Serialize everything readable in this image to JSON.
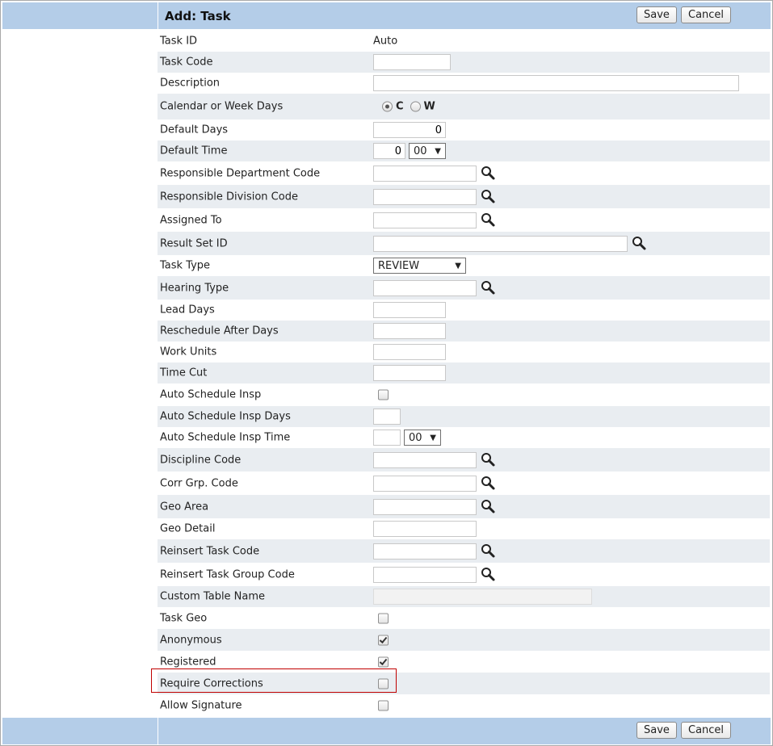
{
  "header": {
    "title": "Add: Task",
    "save_label": "Save",
    "cancel_label": "Cancel"
  },
  "footer": {
    "save_label": "Save",
    "cancel_label": "Cancel"
  },
  "form": {
    "task_id": {
      "label": "Task ID",
      "value": "Auto"
    },
    "task_code": {
      "label": "Task Code",
      "value": ""
    },
    "description": {
      "label": "Description",
      "value": ""
    },
    "calendar_or_week_days": {
      "label": "Calendar or Week Days",
      "options": [
        "C",
        "W"
      ],
      "selected": "C"
    },
    "default_days": {
      "label": "Default Days",
      "value": "0"
    },
    "default_time": {
      "label": "Default Time",
      "hours": "0",
      "minutes": "00"
    },
    "responsible_department_code": {
      "label": "Responsible Department Code",
      "value": ""
    },
    "responsible_division_code": {
      "label": "Responsible Division Code",
      "value": ""
    },
    "assigned_to": {
      "label": "Assigned To",
      "value": ""
    },
    "result_set_id": {
      "label": "Result Set ID",
      "value": ""
    },
    "task_type": {
      "label": "Task Type",
      "value": "REVIEW"
    },
    "hearing_type": {
      "label": "Hearing Type",
      "value": ""
    },
    "lead_days": {
      "label": "Lead Days",
      "value": ""
    },
    "reschedule_after_days": {
      "label": "Reschedule After Days",
      "value": ""
    },
    "work_units": {
      "label": "Work Units",
      "value": ""
    },
    "time_cut": {
      "label": "Time Cut",
      "value": ""
    },
    "auto_schedule_insp": {
      "label": "Auto Schedule Insp",
      "checked": false
    },
    "auto_schedule_insp_days": {
      "label": "Auto Schedule Insp Days",
      "value": ""
    },
    "auto_schedule_insp_time": {
      "label": "Auto Schedule Insp Time",
      "hours": "",
      "minutes": "00"
    },
    "discipline_code": {
      "label": "Discipline Code",
      "value": ""
    },
    "corr_grp_code": {
      "label": "Corr Grp. Code",
      "value": ""
    },
    "geo_area": {
      "label": "Geo Area",
      "value": ""
    },
    "geo_detail": {
      "label": "Geo Detail",
      "value": ""
    },
    "reinsert_task_code": {
      "label": "Reinsert Task Code",
      "value": ""
    },
    "reinsert_task_group_code": {
      "label": "Reinsert Task Group Code",
      "value": ""
    },
    "custom_table_name": {
      "label": "Custom Table Name",
      "value": ""
    },
    "task_geo": {
      "label": "Task Geo",
      "checked": false
    },
    "anonymous": {
      "label": "Anonymous",
      "checked": true
    },
    "registered": {
      "label": "Registered",
      "checked": true
    },
    "require_corrections": {
      "label": "Require Corrections",
      "checked": false
    },
    "allow_signature": {
      "label": "Allow Signature",
      "checked": false
    }
  },
  "colors": {
    "bar": "#b4cde8",
    "row_alt": "#e9edf1",
    "highlight": "#c00000"
  }
}
